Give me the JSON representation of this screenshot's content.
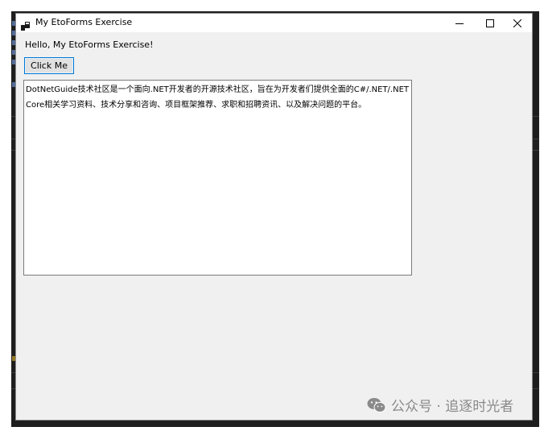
{
  "window": {
    "title": "My EtoForms Exercise",
    "controls": {
      "minimize": "minimize-icon",
      "maximize": "maximize-icon",
      "close": "close-icon"
    }
  },
  "content": {
    "greeting": "Hello, My EtoForms Exercise!",
    "button_label": "Click Me",
    "text_area_value": "DotNetGuide技术社区是一个面向.NET开发者的开源技术社区，旨在为开发者们提供全面的C#/.NET/.NET Core相关学习资料、技术分享和咨询、项目框架推荐、求职和招聘资讯、以及解决问题的平台。"
  },
  "watermark": {
    "icon": "wechat-icon",
    "text": "公众号 · 追逐时光者"
  },
  "colors": {
    "focus_border": "#0078d7",
    "window_bg": "#f0f0f0",
    "backdrop": "#1e1e1e"
  }
}
